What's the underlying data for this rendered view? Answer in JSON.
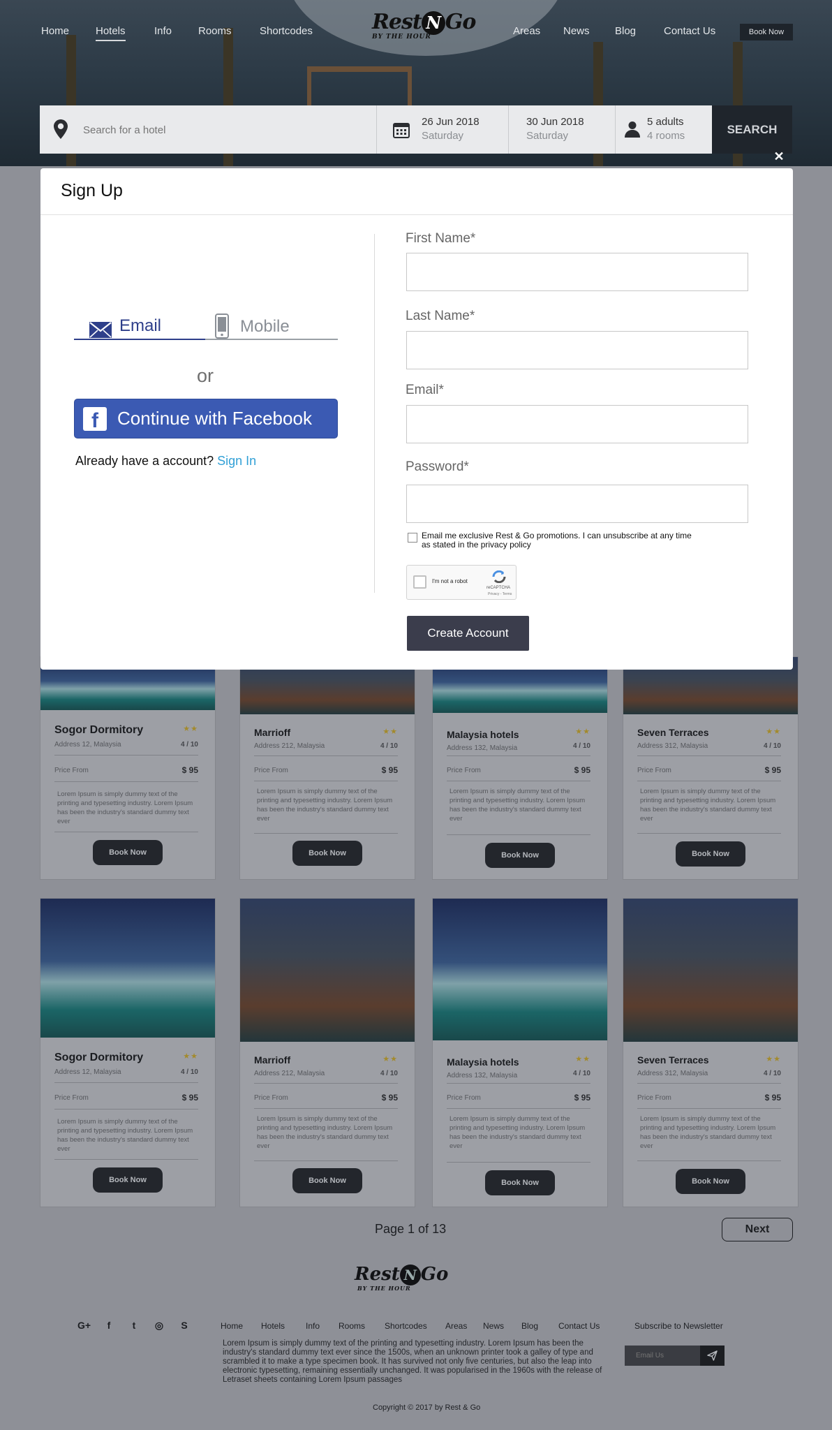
{
  "nav": {
    "left": [
      "Home",
      "Hotels",
      "Info",
      "Rooms",
      "Shortcodes"
    ],
    "right": [
      "Areas",
      "News",
      "Blog",
      "Contact Us"
    ],
    "book_now": "Book Now"
  },
  "logo": {
    "word1": "Rest",
    "n": "N",
    "word2": "Go",
    "tagline": "BY THE HOUR"
  },
  "search": {
    "placeholder": "Search for a hotel",
    "checkin_date": "26 Jun 2018",
    "checkin_day": "Saturday",
    "checkout_date": "30 Jun 2018",
    "checkout_day": "Saturday",
    "guests": "5 adults",
    "rooms": "4 rooms",
    "button": "SEARCH"
  },
  "modal": {
    "close": "✕",
    "title": "Sign Up",
    "tab_email": "Email",
    "tab_mobile": "Mobile",
    "or": "or",
    "facebook": "Continue with Facebook",
    "have_account": "Already have a account?",
    "sign_in": "Sign In",
    "first_name": "First Name*",
    "last_name": "Last Name*",
    "email": "Email*",
    "password": "Password*",
    "promo": "Email me exclusive Rest & Go promotions. I can unsubscribe at any time as stated in the privacy policy",
    "captcha_label": "I'm not a robot",
    "captcha_brand": "reCAPTCHA",
    "captcha_terms": "Privacy - Terms",
    "create": "Create Account"
  },
  "cards_row1": [
    {
      "name": "Sogor Dormitory",
      "stars": "★★",
      "address": "Address 12, Malaysia",
      "rating": "4 / 10",
      "price_label": "Price From",
      "price": "$ 95",
      "desc": "Lorem Ipsum is simply dummy text of the printing and typesetting industry. Lorem Ipsum has been the industry's standard dummy text ever",
      "button": "Book Now"
    },
    {
      "name": "Marrioff",
      "stars": "★★",
      "address": "Address 212, Malaysia",
      "rating": "4 / 10",
      "price_label": "Price From",
      "price": "$ 95",
      "desc": "Lorem Ipsum is simply dummy text of the printing and typesetting industry. Lorem Ipsum has been the industry's standard dummy text ever",
      "button": "Book Now"
    },
    {
      "name": "Malaysia hotels",
      "stars": "★★",
      "address": "Address 132, Malaysia",
      "rating": "4 / 10",
      "price_label": "Price From",
      "price": "$ 95",
      "desc": "Lorem Ipsum is simply dummy text of the printing and typesetting industry. Lorem Ipsum has been the industry's standard dummy text ever",
      "button": "Book Now"
    },
    {
      "name": "Seven Terraces",
      "stars": "★★",
      "address": "Address 312, Malaysia",
      "rating": "4 / 10",
      "price_label": "Price From",
      "price": "$ 95",
      "desc": "Lorem Ipsum is simply dummy text of the printing and typesetting industry. Lorem Ipsum has been the industry's standard dummy text ever",
      "button": "Book Now"
    }
  ],
  "cards_row2": [
    {
      "name": "Sogor Dormitory",
      "stars": "★★",
      "address": "Address 12, Malaysia",
      "rating": "4 / 10",
      "price_label": "Price From",
      "price": "$ 95",
      "desc": "Lorem Ipsum is simply dummy text of the printing and typesetting industry. Lorem Ipsum has been the industry's standard dummy text ever",
      "button": "Book Now"
    },
    {
      "name": "Marrioff",
      "stars": "★★",
      "address": "Address 212, Malaysia",
      "rating": "4 / 10",
      "price_label": "Price From",
      "price": "$ 95",
      "desc": "Lorem Ipsum is simply dummy text of the printing and typesetting industry. Lorem Ipsum has been the industry's standard dummy text ever",
      "button": "Book Now"
    },
    {
      "name": "Malaysia hotels",
      "stars": "★★",
      "address": "Address 132, Malaysia",
      "rating": "4 / 10",
      "price_label": "Price From",
      "price": "$ 95",
      "desc": "Lorem Ipsum is simply dummy text of the printing and typesetting industry. Lorem Ipsum has been the industry's standard dummy text ever",
      "button": "Book Now"
    },
    {
      "name": "Seven Terraces",
      "stars": "★★",
      "address": "Address 312, Malaysia",
      "rating": "4 / 10",
      "price_label": "Price From",
      "price": "$ 95",
      "desc": "Lorem Ipsum is simply dummy text of the printing and typesetting industry. Lorem Ipsum has been the industry's standard dummy text ever",
      "button": "Book Now"
    }
  ],
  "pagination": {
    "label": "Page 1 of 13",
    "next": "Next"
  },
  "footer": {
    "nav": [
      "Home",
      "Hotels",
      "Info",
      "Rooms",
      "Shortcodes",
      "Areas",
      "News",
      "Blog",
      "Contact Us"
    ],
    "social": [
      "G+",
      "f",
      "t",
      "◎",
      "S"
    ],
    "text": "Lorem Ipsum is simply dummy text of the printing and typesetting industry. Lorem Ipsum has been the industry's standard dummy text ever since the 1500s, when an unknown printer took a galley of type and scrambled it to make a type specimen book. It has survived not only five centuries, but also the leap into electronic typesetting, remaining essentially unchanged. It was popularised in the 1960s with the release of Letraset sheets containing Lorem Ipsum passages",
    "subscribe_title": "Subscribe to Newsletter",
    "subscribe_placeholder": "Email Us",
    "copyright": "Copyright © 2017 by Rest & Go"
  }
}
